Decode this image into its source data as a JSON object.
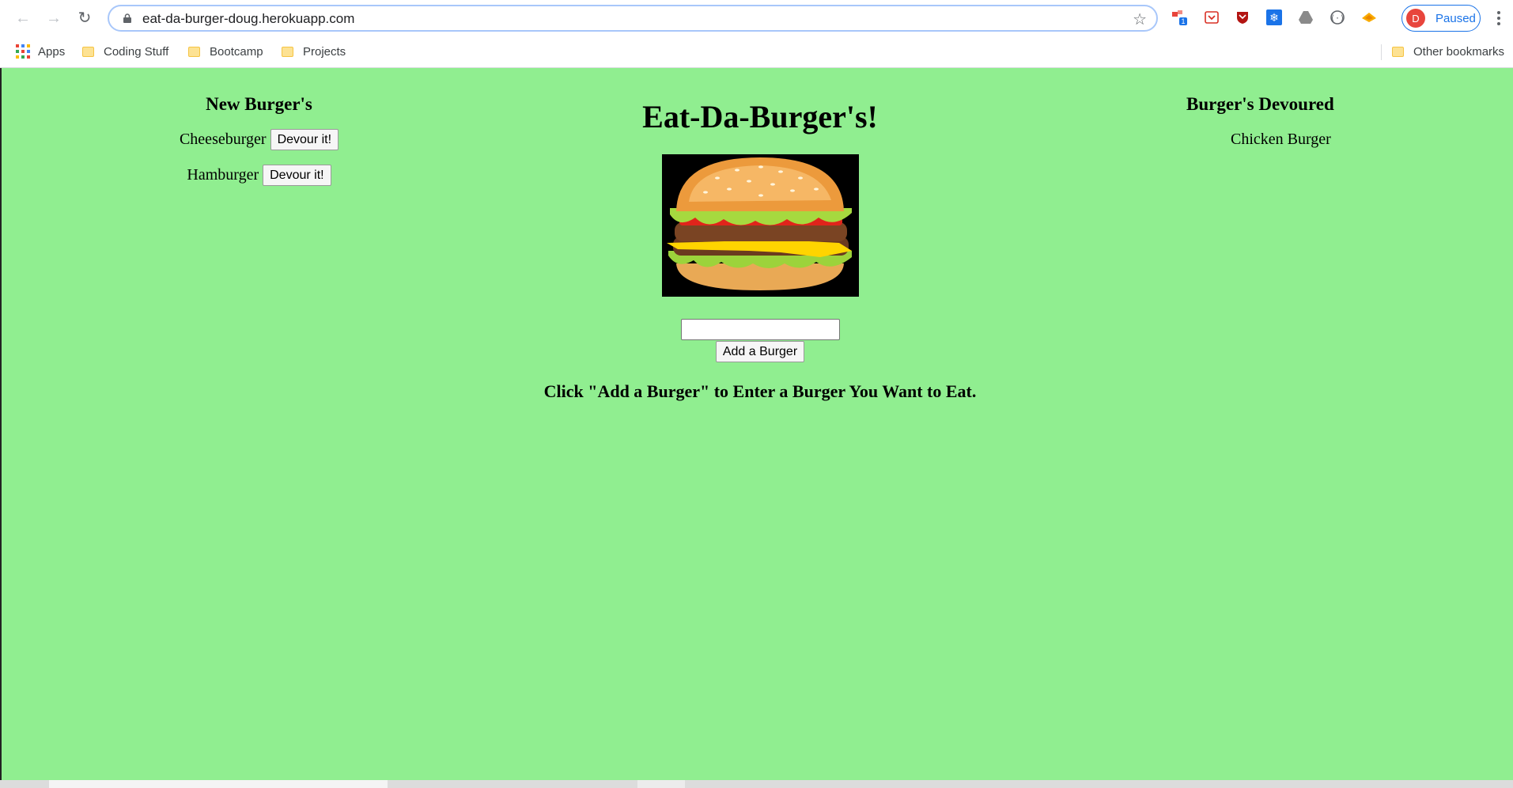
{
  "browser": {
    "url": "eat-da-burger-doug.herokuapp.com",
    "profile": {
      "initial": "D",
      "status": "Paused",
      "avatar_color": "#e8453c"
    },
    "bookmarks": [
      {
        "label": "Apps",
        "type": "apps"
      },
      {
        "label": "Coding Stuff",
        "type": "folder"
      },
      {
        "label": "Bootcamp",
        "type": "folder"
      },
      {
        "label": "Projects",
        "type": "folder"
      }
    ],
    "other_bookmarks": "Other bookmarks",
    "extension_badge": "1"
  },
  "page": {
    "background": "#90ee90",
    "title": "Eat-Da-Burger's!",
    "new_burgers_heading": "New Burger's",
    "devoured_heading": "Burger's Devoured",
    "new_burgers": [
      {
        "name": "Cheeseburger",
        "button": "Devour it!"
      },
      {
        "name": "Hamburger",
        "button": "Devour it!"
      }
    ],
    "devoured_burgers": [
      "Chicken Burger"
    ],
    "input_value": "",
    "add_button": "Add a Burger",
    "instructions": "Click \"Add a Burger\" to Enter a Burger You Want to Eat."
  }
}
